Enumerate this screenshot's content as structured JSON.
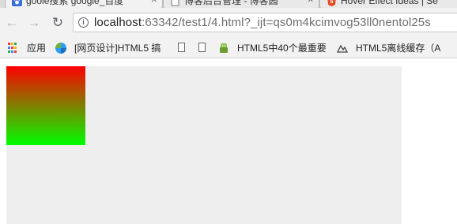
{
  "tabs": [
    {
      "label": "goole搜索 google_百度",
      "favicon": "paw-icon"
    },
    {
      "label": "博客后台管理 - 博客园",
      "favicon": "page-icon"
    },
    {
      "label": "Hover Effect Ideas | Se",
      "favicon": "html5-icon"
    }
  ],
  "toolbar": {
    "url_host": "localhost",
    "url_rest": ":63342/test1/4.html?_ijt=qs0m4kcimvog53ll0nentol25s"
  },
  "bookmarks": [
    {
      "label": "应用",
      "icon": "apps-grid-icon"
    },
    {
      "label": "[网页设计]HTML5 搞",
      "icon": "pinwheel-icon"
    },
    {
      "label": "",
      "icon": "page-icon"
    },
    {
      "label": "",
      "icon": "page-icon"
    },
    {
      "label": "HTML5中40个最重要",
      "icon": "android-icon"
    },
    {
      "label": "HTML5离线缓存（A",
      "icon": "mountain-icon"
    }
  ],
  "page": {
    "gradient_top_color": "#ff0000",
    "gradient_bottom_color": "#00ff00",
    "container_color": "#eeeeee"
  }
}
